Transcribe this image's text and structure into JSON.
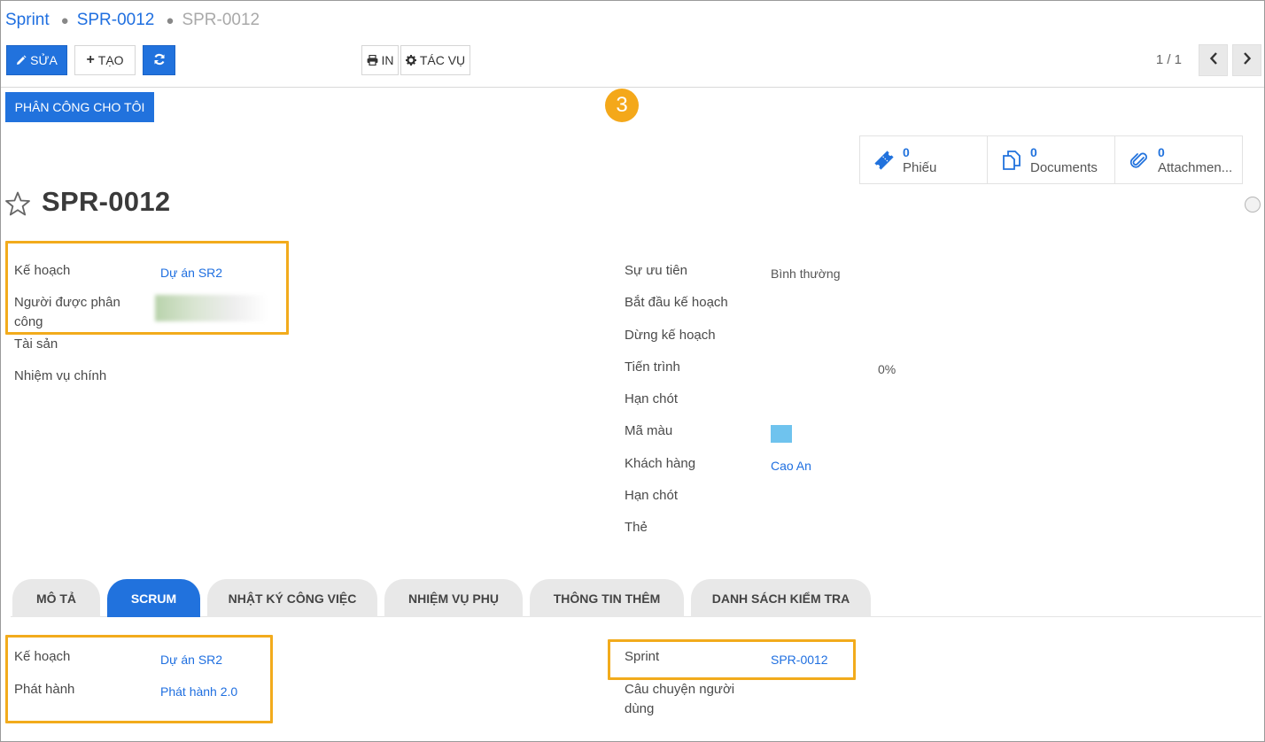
{
  "breadcrumb": {
    "root": "Sprint",
    "parent": "SPR-0012",
    "current": "SPR-0012"
  },
  "toolbar": {
    "edit_label": "SỬA",
    "create_label": "TẠO",
    "print_label": "IN",
    "action_label": "TÁC VỤ",
    "pager": "1 / 1"
  },
  "assign_button": "PHÂN CÔNG CHO TÔI",
  "step_badge": "3",
  "stat_buttons": [
    {
      "count": "0",
      "label": "Phiếu",
      "icon": "ticket-icon"
    },
    {
      "count": "0",
      "label": "Documents",
      "icon": "documents-icon"
    },
    {
      "count": "0",
      "label": "Attachmen...",
      "icon": "paperclip-icon"
    }
  ],
  "record": {
    "title": "SPR-0012"
  },
  "left_fields": {
    "plan_label": "Kế hoạch",
    "plan_value": "Dự án SR2",
    "assignee_label": "Người được phân công",
    "asset_label": "Tài sản",
    "main_task_label": "Nhiệm vụ chính"
  },
  "right_fields": {
    "priority_label": "Sự ưu tiên",
    "priority_value": "Bình thường",
    "start_label": "Bắt đầu kế hoạch",
    "stop_label": "Dừng kế hoạch",
    "progress_label": "Tiến trình",
    "progress_value": "0%",
    "deadline_label": "Hạn chót",
    "color_label": "Mã màu",
    "color_value": "#6fc3ee",
    "customer_label": "Khách hàng",
    "customer_value": "Cao An",
    "deadline2_label": "Hạn chót",
    "tag_label": "Thẻ"
  },
  "tabs": [
    "MÔ TẢ",
    "SCRUM",
    "NHẬT KÝ CÔNG VIỆC",
    "NHIỆM VỤ PHỤ",
    "THÔNG TIN THÊM",
    "DANH SÁCH KIỂM TRA"
  ],
  "active_tab": "SCRUM",
  "scrum": {
    "plan_label": "Kế hoạch",
    "plan_value": "Dự án SR2",
    "release_label": "Phát hành",
    "release_value": "Phát hành 2.0",
    "sprint_label": "Sprint",
    "sprint_value": "SPR-0012",
    "story_label": "Câu chuyện người dùng"
  },
  "colors": {
    "primary": "#2172dd",
    "highlight": "#f2ab1c",
    "link": "#1f6fe0"
  }
}
